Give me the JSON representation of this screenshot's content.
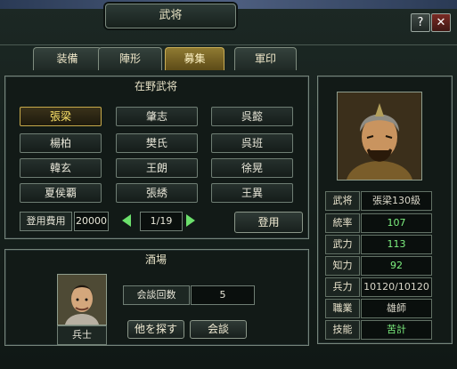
{
  "window": {
    "title": "武将",
    "help_label": "?",
    "close_label": "✕"
  },
  "tabs": [
    {
      "label": "装備"
    },
    {
      "label": "陣形"
    },
    {
      "label": "募集",
      "active": true
    },
    {
      "label": "軍印"
    }
  ],
  "recruit_panel": {
    "title": "在野武将",
    "generals": [
      [
        "張梁",
        "肇志",
        "呉懿"
      ],
      [
        "楊柏",
        "樊氏",
        "呉班"
      ],
      [
        "韓玄",
        "王朗",
        "徐晃"
      ],
      [
        "夏侯覇",
        "張綉",
        "王異"
      ]
    ],
    "selected_general": "張梁",
    "fee_label": "登用費用",
    "fee_value": "20000",
    "page_indicator": "1/19",
    "recruit_button": "登用"
  },
  "tavern_panel": {
    "title": "酒場",
    "portrait_label": "兵士",
    "talk_count_label": "会談回数",
    "talk_count_value": "5",
    "search_button": "他を探す",
    "talk_button": "会談"
  },
  "selected_general": {
    "stats": [
      {
        "label": "武将",
        "value": "張梁130級"
      },
      {
        "label": "統率",
        "value": "107"
      },
      {
        "label": "武力",
        "value": "113"
      },
      {
        "label": "知力",
        "value": "92"
      },
      {
        "label": "兵力",
        "value": "10120/10120"
      },
      {
        "label": "職業",
        "value": "雄師"
      },
      {
        "label": "技能",
        "value": "苦計"
      }
    ]
  },
  "colors": {
    "gold": "#c7aa4a",
    "green_value": "#7df07f",
    "selected_text": "#ffe56a"
  }
}
